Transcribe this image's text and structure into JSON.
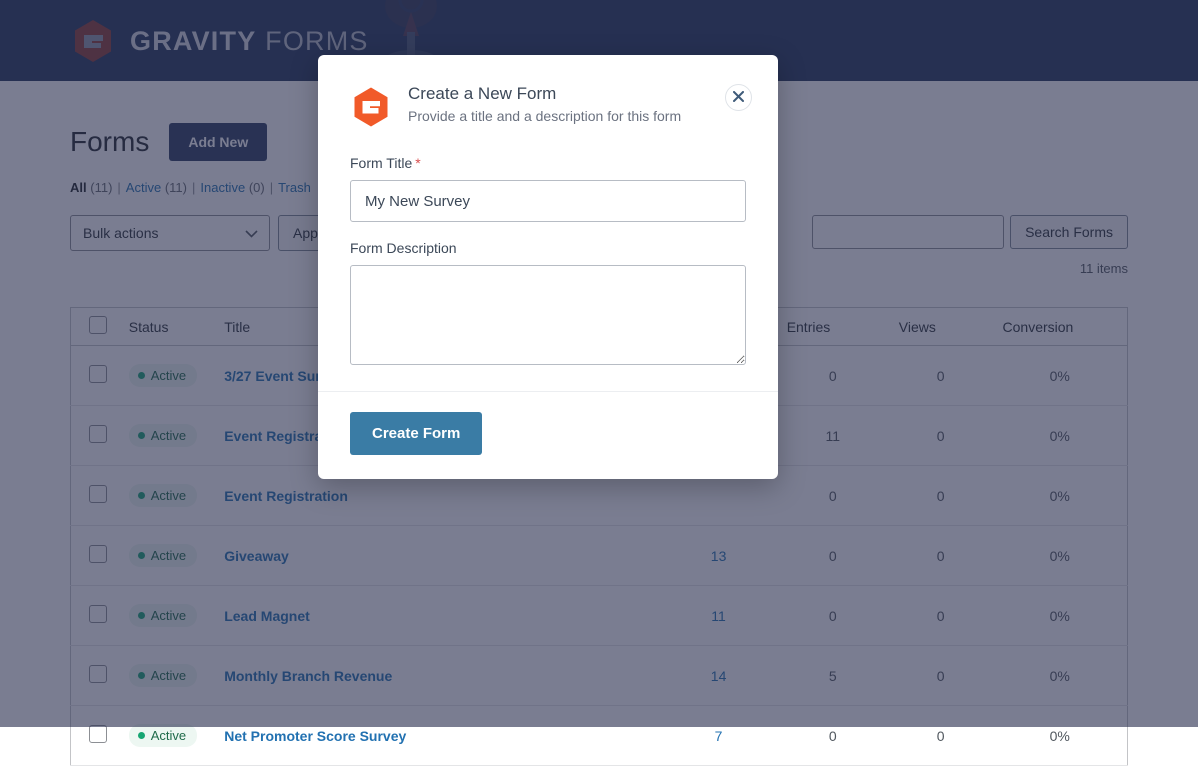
{
  "header": {
    "brand_bold": "GRAVITY",
    "brand_light": "FORMS",
    "logo_icon": "gravity-forms-hexagon-logo",
    "decoration_icon": "rocket-illustration"
  },
  "page": {
    "title": "Forms",
    "add_new_label": "Add New",
    "filters": [
      {
        "label": "All",
        "count": "(11)",
        "current": true
      },
      {
        "label": "Active",
        "count": "(11)",
        "current": false
      },
      {
        "label": "Inactive",
        "count": "(0)",
        "current": false
      },
      {
        "label": "Trash",
        "count": "",
        "current": false
      }
    ],
    "separator": "|",
    "bulk_actions_value": "Bulk actions",
    "apply_label": "Apply",
    "search_value": "",
    "search_placeholder": "",
    "search_button_label": "Search Forms",
    "items_count": "11 items"
  },
  "table": {
    "columns": [
      "Status",
      "Title",
      "",
      "Entries",
      "Views",
      "Conversion"
    ],
    "rows": [
      {
        "status": "Active",
        "title": "3/27 Event Survey",
        "fields": "",
        "entries": "0",
        "views": "0",
        "conversion": "0%"
      },
      {
        "status": "Active",
        "title": "Event Registration",
        "fields": "",
        "entries": "11",
        "views": "0",
        "conversion": "0%"
      },
      {
        "status": "Active",
        "title": "Event Registration",
        "fields": "",
        "entries": "0",
        "views": "0",
        "conversion": "0%"
      },
      {
        "status": "Active",
        "title": "Giveaway",
        "fields": "13",
        "entries": "0",
        "views": "0",
        "conversion": "0%"
      },
      {
        "status": "Active",
        "title": "Lead Magnet",
        "fields": "11",
        "entries": "0",
        "views": "0",
        "conversion": "0%"
      },
      {
        "status": "Active",
        "title": "Monthly Branch Revenue",
        "fields": "14",
        "entries": "5",
        "views": "0",
        "conversion": "0%"
      },
      {
        "status": "Active",
        "title": "Net Promoter Score Survey",
        "fields": "7",
        "entries": "0",
        "views": "0",
        "conversion": "0%"
      }
    ]
  },
  "modal": {
    "logo_icon": "gravity-forms-hexagon-logo",
    "title": "Create a New Form",
    "subtitle": "Provide a title and a description for this form",
    "close_icon": "close-icon",
    "form_title_label": "Form Title",
    "required_marker": "*",
    "form_title_value": "My New Survey",
    "form_title_placeholder": "",
    "form_description_label": "Form Description",
    "form_description_value": "",
    "form_description_placeholder": "",
    "submit_label": "Create Form"
  },
  "colors": {
    "header_bg": "#243659",
    "brand_orange": "#F15A29",
    "accent_blue": "#2271b1",
    "primary_button": "#3a7ca5",
    "add_new_button": "#2b3b60",
    "status_green": "#17a673",
    "required_red": "#d94f4f",
    "overlay": "rgba(40,45,78,0.62)"
  }
}
